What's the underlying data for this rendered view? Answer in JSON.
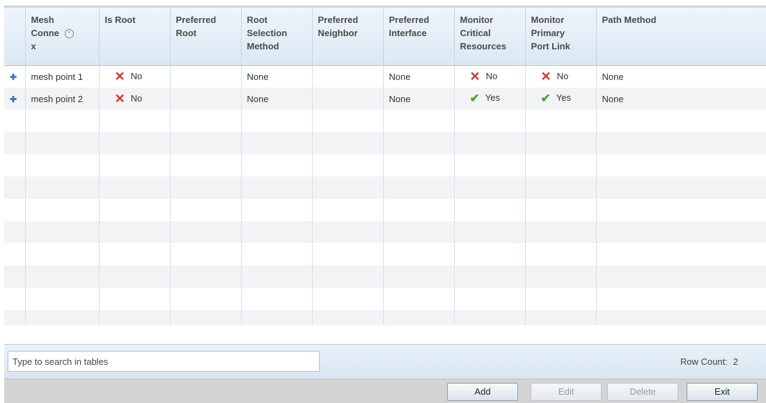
{
  "columns": [
    {
      "label": ""
    },
    {
      "label": "Mesh\nConne\nx",
      "sortable": true
    },
    {
      "label": "Is Root"
    },
    {
      "label": "Preferred\nRoot"
    },
    {
      "label": "Root\nSelection\nMethod"
    },
    {
      "label": "Preferred\nNeighbor"
    },
    {
      "label": "Preferred\nInterface"
    },
    {
      "label": "Monitor\nCritical\nResources"
    },
    {
      "label": "Monitor\nPrimary\nPort Link"
    },
    {
      "label": "Path Method"
    }
  ],
  "rows": [
    {
      "expand": "+",
      "mesh": "mesh point 1",
      "is_root": {
        "icon": "x-icon",
        "text": "No"
      },
      "preferred_root": "",
      "root_selection": "None",
      "preferred_neighbor": "",
      "preferred_interface": "None",
      "monitor_critical": {
        "icon": "x-icon",
        "text": "No"
      },
      "monitor_primary": {
        "icon": "x-icon",
        "text": "No"
      },
      "path_method": "None"
    },
    {
      "expand": "+",
      "mesh": "mesh point 2",
      "is_root": {
        "icon": "x-icon",
        "text": "No"
      },
      "preferred_root": "",
      "root_selection": "None",
      "preferred_neighbor": "",
      "preferred_interface": "None",
      "monitor_critical": {
        "icon": "check-icon",
        "text": "Yes"
      },
      "monitor_primary": {
        "icon": "check-icon",
        "text": "Yes"
      },
      "path_method": "None"
    }
  ],
  "search": {
    "value": "Type to search in tables"
  },
  "row_count": {
    "label": "Row Count:",
    "value": "2"
  },
  "buttons": {
    "add": "Add",
    "edit": "Edit",
    "delete": "Delete",
    "exit": "Exit"
  },
  "colors": {
    "x": "#e03030",
    "check": "#4aa52e",
    "expand": "#3575c2"
  }
}
